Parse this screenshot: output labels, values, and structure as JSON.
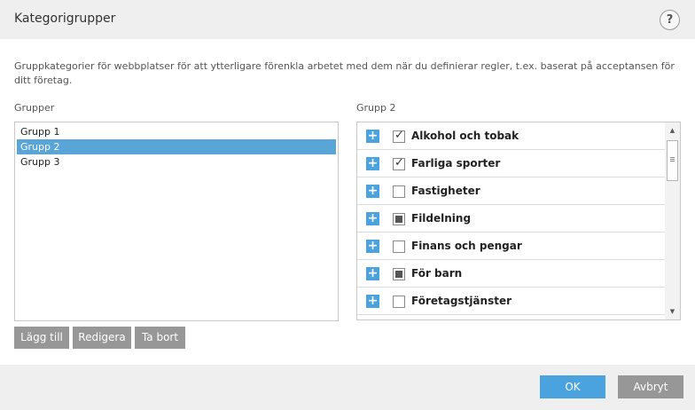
{
  "dialog": {
    "title": "Kategorigrupper",
    "help_label": "?"
  },
  "description": "Gruppkategorier för webbplatser för att ytterligare förenkla arbetet med dem när du definierar regler, t.ex. baserat på acceptansen för ditt företag.",
  "groups": {
    "label": "Grupper",
    "items": [
      {
        "label": "Grupp 1",
        "selected": false
      },
      {
        "label": "Grupp 2",
        "selected": true
      },
      {
        "label": "Grupp 3",
        "selected": false
      }
    ],
    "add_label": "Lägg till",
    "edit_label": "Redigera",
    "remove_label": "Ta bort"
  },
  "categories": {
    "label": "Grupp 2",
    "items": [
      {
        "label": "Alkohol och tobak",
        "state": "checked"
      },
      {
        "label": "Farliga sporter",
        "state": "checked"
      },
      {
        "label": "Fastigheter",
        "state": "unchecked"
      },
      {
        "label": "Fildelning",
        "state": "partial"
      },
      {
        "label": "Finans och pengar",
        "state": "unchecked"
      },
      {
        "label": "För barn",
        "state": "partial"
      },
      {
        "label": "Företagstjänster",
        "state": "unchecked"
      }
    ],
    "expand_symbol": "+"
  },
  "footer": {
    "ok_label": "OK",
    "cancel_label": "Avbryt"
  },
  "colors": {
    "accent": "#4aa3df",
    "selection": "#5aa5d8",
    "secondary_button": "#979797"
  }
}
